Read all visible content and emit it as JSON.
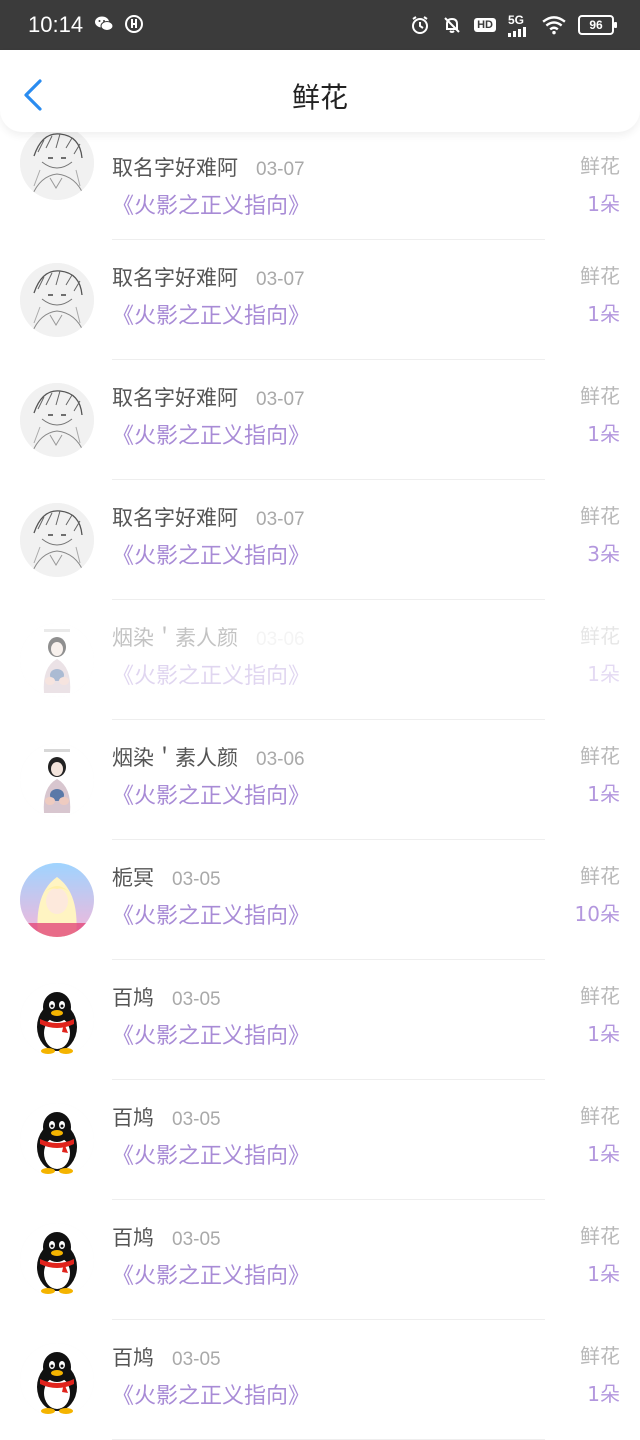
{
  "status_bar": {
    "time": "10:14",
    "network": "5G",
    "hd": "HD",
    "battery": "96"
  },
  "header": {
    "title": "鲜花"
  },
  "records": [
    {
      "name": "取名字好难阿",
      "date": "03-07",
      "book": "《火影之正义指向》",
      "gift": "鲜花",
      "count": "1朵",
      "avatar": "sketch-anime-avatar",
      "faded": false
    },
    {
      "name": "取名字好难阿",
      "date": "03-07",
      "book": "《火影之正义指向》",
      "gift": "鲜花",
      "count": "1朵",
      "avatar": "sketch-anime-avatar",
      "faded": false
    },
    {
      "name": "取名字好难阿",
      "date": "03-07",
      "book": "《火影之正义指向》",
      "gift": "鲜花",
      "count": "1朵",
      "avatar": "sketch-anime-avatar",
      "faded": false
    },
    {
      "name": "取名字好难阿",
      "date": "03-07",
      "book": "《火影之正义指向》",
      "gift": "鲜花",
      "count": "3朵",
      "avatar": "sketch-anime-avatar",
      "faded": false
    },
    {
      "name": "烟染＇素人颜",
      "date": "03-06",
      "book": "《火影之正义指向》",
      "gift": "鲜花",
      "count": "1朵",
      "avatar": "figure-avatar",
      "faded": true
    },
    {
      "name": "烟染＇素人颜",
      "date": "03-06",
      "book": "《火影之正义指向》",
      "gift": "鲜花",
      "count": "1朵",
      "avatar": "figure-avatar",
      "faded": false
    },
    {
      "name": "栀冥",
      "date": "03-05",
      "book": "《火影之正义指向》",
      "gift": "鲜花",
      "count": "10朵",
      "avatar": "blonde-anime-avatar",
      "faded": false
    },
    {
      "name": "百鸠",
      "date": "03-05",
      "book": "《火影之正义指向》",
      "gift": "鲜花",
      "count": "1朵",
      "avatar": "penguin-avatar",
      "faded": false
    },
    {
      "name": "百鸠",
      "date": "03-05",
      "book": "《火影之正义指向》",
      "gift": "鲜花",
      "count": "1朵",
      "avatar": "penguin-avatar",
      "faded": false
    },
    {
      "name": "百鸠",
      "date": "03-05",
      "book": "《火影之正义指向》",
      "gift": "鲜花",
      "count": "1朵",
      "avatar": "penguin-avatar",
      "faded": false
    },
    {
      "name": "百鸠",
      "date": "03-05",
      "book": "《火影之正义指向》",
      "gift": "鲜花",
      "count": "1朵",
      "avatar": "penguin-avatar",
      "faded": false
    }
  ],
  "colors": {
    "accent": "#2a8cf0",
    "book_title": "#a88bd6",
    "count": "#b397de",
    "status_bar_bg": "#3b3b3b"
  }
}
